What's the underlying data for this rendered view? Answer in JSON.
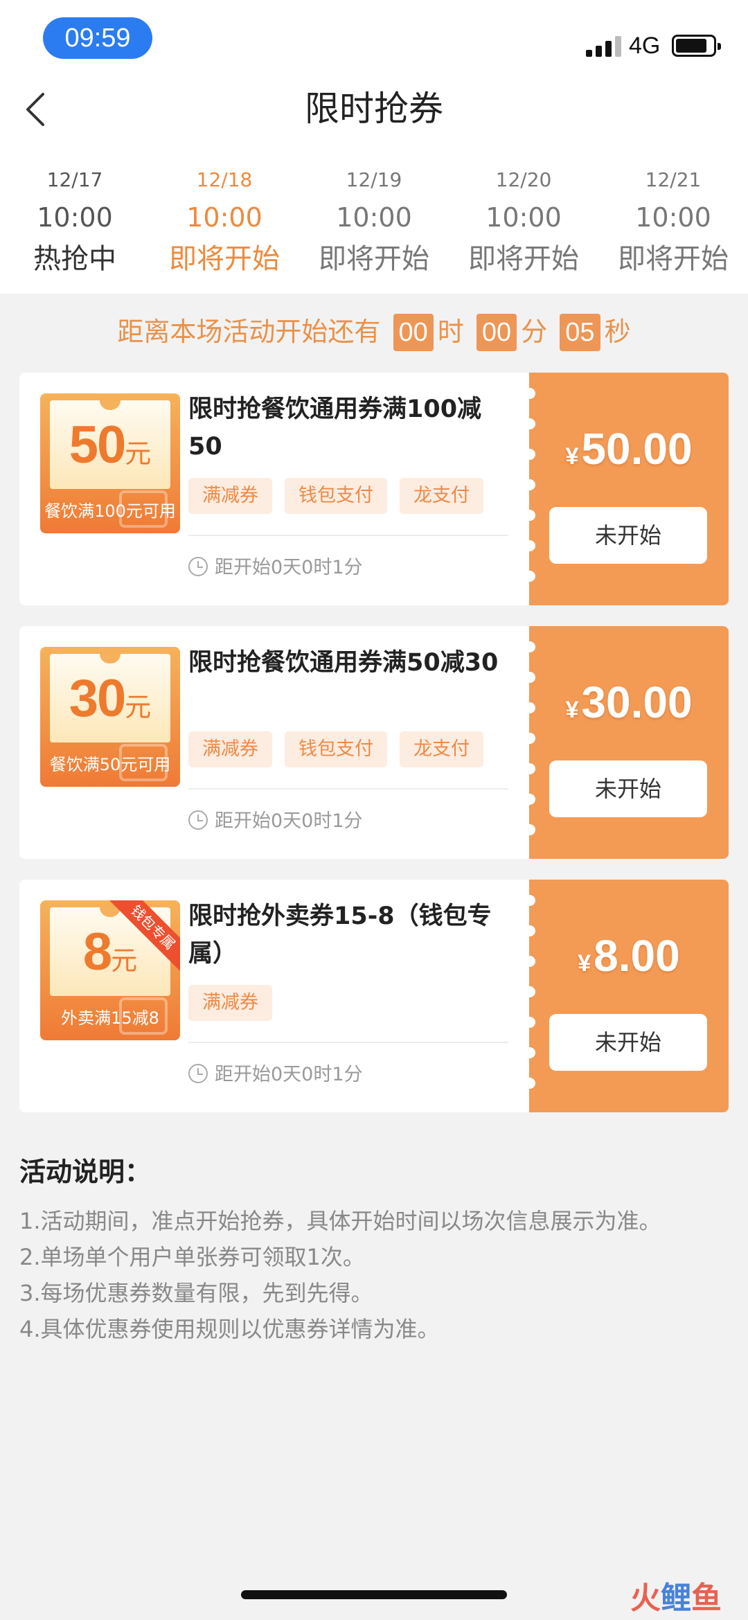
{
  "status_bar": {
    "time": "09:59",
    "network": "4G"
  },
  "nav": {
    "title": "限时抢券"
  },
  "sessions": [
    {
      "date": "12/17",
      "time": "10:00",
      "status": "热抢中"
    },
    {
      "date": "12/18",
      "time": "10:00",
      "status": "即将开始"
    },
    {
      "date": "12/19",
      "time": "10:00",
      "status": "即将开始"
    },
    {
      "date": "12/20",
      "time": "10:00",
      "status": "即将开始"
    },
    {
      "date": "12/21",
      "time": "10:00",
      "status": "即将开始"
    }
  ],
  "countdown": {
    "prefix": "距离本场活动开始还有",
    "hours": "00",
    "hours_unit": "时",
    "minutes": "00",
    "minutes_unit": "分",
    "seconds": "05",
    "seconds_unit": "秒"
  },
  "coupons": [
    {
      "thumb_amount": "50",
      "thumb_unit": "元",
      "thumb_condition": "餐饮满100元可用",
      "title": "限时抢餐饮通用券满100减50",
      "tags": [
        "满减券",
        "钱包支付",
        "龙支付"
      ],
      "start_in": "距开始0天0时1分",
      "currency": "¥",
      "price": "50.00",
      "button": "未开始"
    },
    {
      "thumb_amount": "30",
      "thumb_unit": "元",
      "thumb_condition": "餐饮满50元可用",
      "title": "限时抢餐饮通用券满50减30",
      "tags": [
        "满减券",
        "钱包支付",
        "龙支付"
      ],
      "start_in": "距开始0天0时1分",
      "currency": "¥",
      "price": "30.00",
      "button": "未开始"
    },
    {
      "thumb_amount": "8",
      "thumb_unit": "元",
      "thumb_condition": "外卖满15减8",
      "ribbon": "钱包专属",
      "title": "限时抢外卖券15-8（钱包专属）",
      "tags": [
        "满减券"
      ],
      "start_in": "距开始0天0时1分",
      "currency": "¥",
      "price": "8.00",
      "button": "未开始"
    }
  ],
  "rules": {
    "title": "活动说明：",
    "items": [
      "1.活动期间，准点开始抢券，具体开始时间以场次信息展示为准。",
      "2.单场单个用户单张券可领取1次。",
      "3.每场优惠券数量有限，先到先得。",
      "4.具体优惠券使用规则以优惠券详情为准。"
    ]
  },
  "watermark": {
    "part1": "火",
    "part2": "鲤",
    "part3": "鱼"
  },
  "colors": {
    "accent": "#f39a55",
    "active_tab": "#ee8a3c",
    "time_pill": "#2b7cf0",
    "tag_bg": "#fdece0"
  }
}
